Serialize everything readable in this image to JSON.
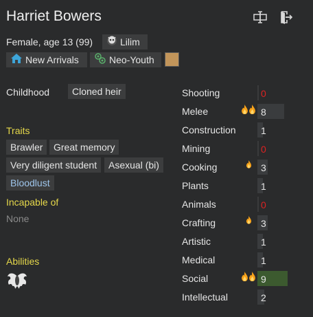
{
  "pawn": {
    "name": "Harriet Bowers",
    "description": "Female, age 13 (99)",
    "xenotype": "Lilim",
    "faction": "New Arrivals",
    "ideo": "Neo-Youth",
    "favorite_color": "#c2955a"
  },
  "header_icons": [
    "rename-icon",
    "banish-icon"
  ],
  "backstory": {
    "label": "Childhood",
    "value": "Cloned heir"
  },
  "traits": {
    "label": "Traits",
    "items": [
      "Brawler",
      "Great memory",
      "Very diligent student",
      "Asexual (bi)",
      "Bloodlust"
    ]
  },
  "incapable": {
    "label": "Incapable of",
    "value": "None"
  },
  "abilities": {
    "label": "Abilities"
  },
  "skills": [
    {
      "name": "Shooting",
      "level": 0,
      "passion": "none"
    },
    {
      "name": "Melee",
      "level": 8,
      "passion": "major"
    },
    {
      "name": "Construction",
      "level": 1,
      "passion": "none"
    },
    {
      "name": "Mining",
      "level": 0,
      "passion": "none"
    },
    {
      "name": "Cooking",
      "level": 3,
      "passion": "minor"
    },
    {
      "name": "Plants",
      "level": 1,
      "passion": "none"
    },
    {
      "name": "Animals",
      "level": 0,
      "passion": "none"
    },
    {
      "name": "Crafting",
      "level": 3,
      "passion": "minor"
    },
    {
      "name": "Artistic",
      "level": 1,
      "passion": "none"
    },
    {
      "name": "Medical",
      "level": 1,
      "passion": "none"
    },
    {
      "name": "Social",
      "level": 9,
      "passion": "major"
    },
    {
      "name": "Intellectual",
      "level": 2,
      "passion": "none"
    }
  ]
}
